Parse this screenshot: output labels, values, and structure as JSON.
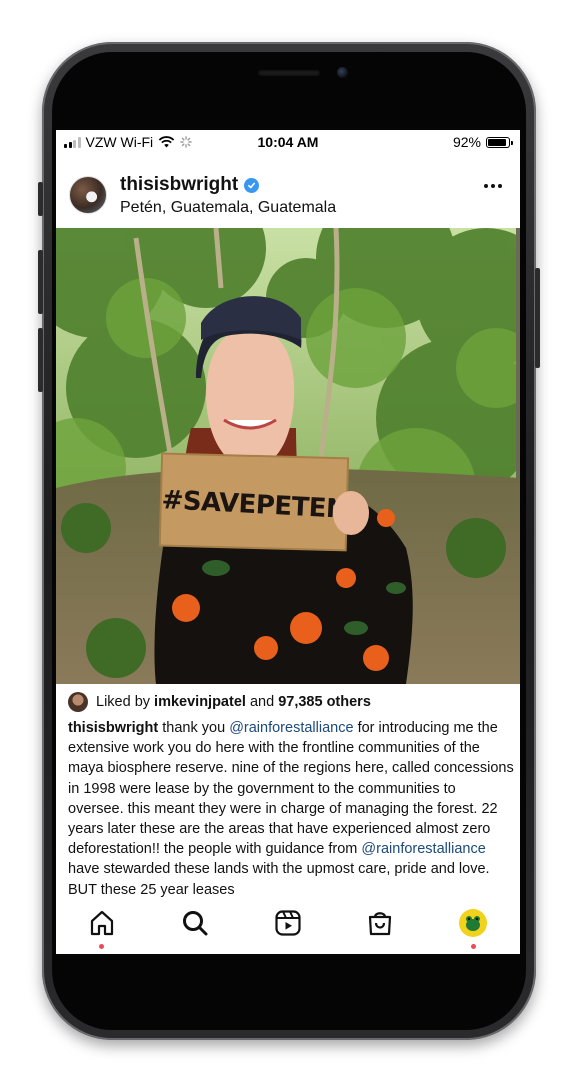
{
  "status_bar": {
    "carrier": "VZW Wi-Fi",
    "time": "10:04 AM",
    "battery": "92%",
    "battery_level": 0.92
  },
  "post": {
    "username": "thisisbwright",
    "verified": true,
    "location": "Petén, Guatemala, Guatemala",
    "sign_text": "#SAVEPETEN",
    "likes": {
      "prefix": "Liked by",
      "liker": "imkevinjpatel",
      "joiner": "and",
      "others": "97,385 others"
    },
    "caption": {
      "username": "thisisbwright",
      "part1": "thank you",
      "mention1": "@rainforestalliance",
      "part2": "for introducing me the extensive work you do here with the frontline communities of the maya biosphere reserve. nine of the regions here, called concessions in 1998 were lease by the government to the communities to oversee. this meant they were in charge of managing the forest. 22 years later these are the areas that have experienced almost zero deforestation!! the people with guidance from",
      "mention2": "@rainforestalliance",
      "part3": "have stewarded these lands with the upmost care, pride and love. BUT these 25 year leases"
    }
  },
  "nav": {
    "items": [
      {
        "icon": "home-icon",
        "notification": true
      },
      {
        "icon": "search-icon",
        "notification": false
      },
      {
        "icon": "reels-icon",
        "notification": false
      },
      {
        "icon": "shop-icon",
        "notification": false
      },
      {
        "icon": "profile-icon",
        "notification": true
      }
    ]
  },
  "colors": {
    "verified_badge": "#3897f0",
    "mention": "#1c4a7a",
    "notification_dot": "#ed4956"
  }
}
